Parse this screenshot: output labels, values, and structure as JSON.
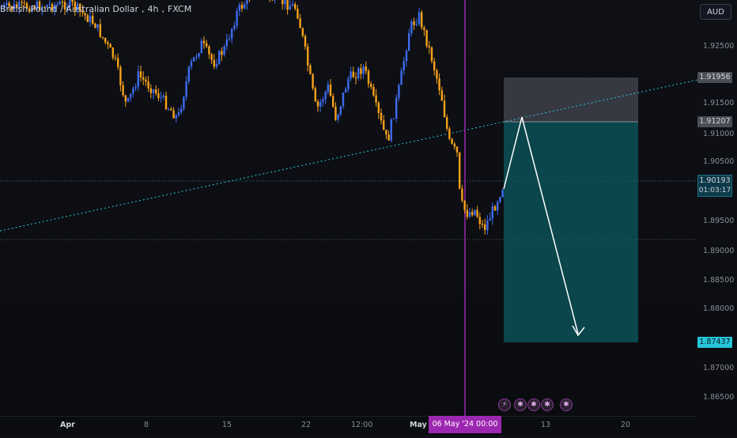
{
  "header": {
    "symbol_name": "British Pound / Australian Dollar",
    "timeframe": "4h",
    "exchange": "FXCM"
  },
  "currency_button": "AUD",
  "price_axis": {
    "ticks": [
      "1.92500",
      "1.91500",
      "1.91000",
      "1.90500",
      "1.89500",
      "1.89000",
      "1.88500",
      "1.88000",
      "1.87000",
      "1.86500"
    ],
    "labels": {
      "stop_level": "1.91956",
      "entry_level": "1.91207",
      "current_price": "1.90193",
      "countdown": "01:03:17",
      "target_level": "1.87437"
    },
    "label_colors": {
      "stop_bg": "#4a4d56",
      "entry_bg": "#4a4d56",
      "current_bg": "#0d3a4a",
      "target_bg": "#26c6da"
    }
  },
  "time_axis": {
    "ticks": [
      "Apr",
      "8",
      "15",
      "22",
      "12:00",
      "May",
      "13",
      "20"
    ],
    "crosshair_label": "06 May '24   00:00"
  },
  "colors": {
    "up_candle": "#3d6cf0",
    "down_candle": "#f7a21b",
    "trendline": "#26c6da",
    "vertical_line": "#9c27b0",
    "stop_zone": "#5a5d66",
    "target_zone": "#0a5a5f"
  },
  "events": [
    "lightning-icon",
    "flag-icon-uk",
    "flag-icon-uk",
    "flag-icon-au",
    "flag-icon-uk"
  ]
}
